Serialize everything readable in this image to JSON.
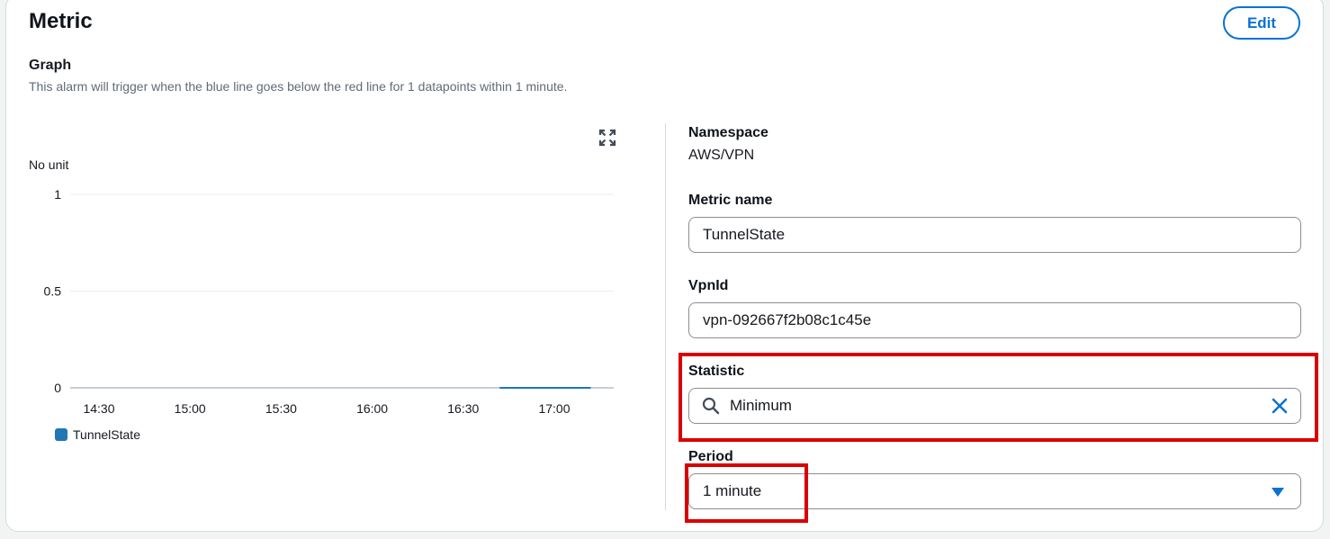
{
  "section": {
    "title": "Metric",
    "edit_label": "Edit"
  },
  "graph": {
    "label": "Graph",
    "description": "This alarm will trigger when the blue line goes below the red line for 1 datapoints within 1 minute.",
    "unit": "No unit"
  },
  "chart_data": {
    "type": "line",
    "x_ticks": [
      "14:30",
      "15:00",
      "15:30",
      "16:00",
      "16:30",
      "17:00"
    ],
    "y_ticks": [
      "1",
      "0.5",
      "0"
    ],
    "ylim": [
      0,
      1
    ],
    "grid": true,
    "series": [
      {
        "name": "TunnelState",
        "color": "#1f77b4",
        "x": [
          "16:42",
          "17:12"
        ],
        "values": [
          0,
          0
        ]
      }
    ],
    "legend_position": "bottom-left"
  },
  "details": {
    "namespace_label": "Namespace",
    "namespace_value": "AWS/VPN",
    "metric_name_label": "Metric name",
    "metric_name_value": "TunnelState",
    "vpnid_label": "VpnId",
    "vpnid_value": "vpn-092667f2b08c1c45e",
    "statistic_label": "Statistic",
    "statistic_value": "Minimum",
    "period_label": "Period",
    "period_value": "1 minute"
  },
  "icons": {
    "expand": "expand-icon",
    "search": "search-icon",
    "clear": "close-icon",
    "dropdown": "caret-down-icon"
  },
  "colors": {
    "accent": "#0972d3",
    "highlight": "#d90000",
    "series": "#1f77b4"
  }
}
